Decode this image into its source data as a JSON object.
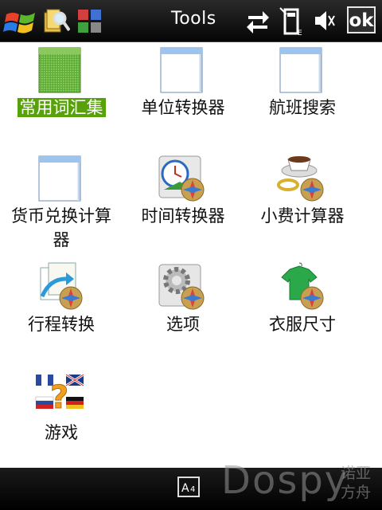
{
  "titlebar": {
    "title": "Tools",
    "ok_label": "ok",
    "icons": [
      "windows-start-icon",
      "file-explorer-icon",
      "app-grid-icon",
      "sync-arrows-icon",
      "signal-icon",
      "volume-mute-icon"
    ]
  },
  "items": [
    {
      "label": "常用词汇集",
      "icon": "green-window-icon",
      "selected": true
    },
    {
      "label": "单位转换器",
      "icon": "blank-window-icon"
    },
    {
      "label": "航班搜索",
      "icon": "blank-window-icon"
    },
    {
      "label": "货币兑换计算器",
      "label_line1": "货币兑换计算",
      "label_line2": "器",
      "icon": "blank-window-icon"
    },
    {
      "label": "时间转换器",
      "icon": "time-converter-icon"
    },
    {
      "label": "小费计算器",
      "icon": "tip-calculator-icon"
    },
    {
      "label": "行程转换",
      "icon": "itinerary-icon"
    },
    {
      "label": "选项",
      "icon": "options-gear-icon"
    },
    {
      "label": "衣服尺寸",
      "icon": "clothes-size-icon"
    },
    {
      "label": "游戏",
      "icon": "games-icon"
    }
  ],
  "bottombar": {
    "sip_icon": "keyboard-sip-icon"
  },
  "watermark": {
    "brand": "Dospy",
    "sub1": "诺亚",
    "sub2": "方舟"
  }
}
